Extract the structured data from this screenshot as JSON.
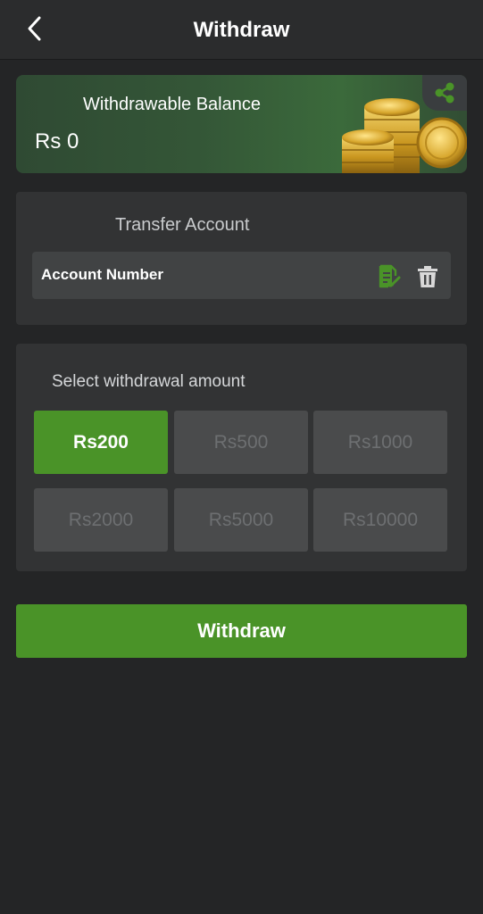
{
  "header": {
    "title": "Withdraw",
    "back_icon": "chevron-left-icon"
  },
  "balance": {
    "label": "Withdrawable Balance",
    "value": "Rs 0",
    "share_icon": "share-icon",
    "decoration": "gold-coins-image"
  },
  "transfer": {
    "title": "Transfer Account",
    "account_label": "Account Number",
    "edit_icon": "edit-document-icon",
    "delete_icon": "trash-icon"
  },
  "amounts": {
    "title": "Select withdrawal amount",
    "options": [
      {
        "label": "Rs200",
        "selected": true
      },
      {
        "label": "Rs500",
        "selected": false
      },
      {
        "label": "Rs1000",
        "selected": false
      },
      {
        "label": "Rs2000",
        "selected": false
      },
      {
        "label": "Rs5000",
        "selected": false
      },
      {
        "label": "Rs10000",
        "selected": false
      }
    ]
  },
  "submit": {
    "label": "Withdraw"
  },
  "colors": {
    "accent": "#4a9328",
    "background": "#242526",
    "panel": "#323334",
    "card": "#345637"
  }
}
